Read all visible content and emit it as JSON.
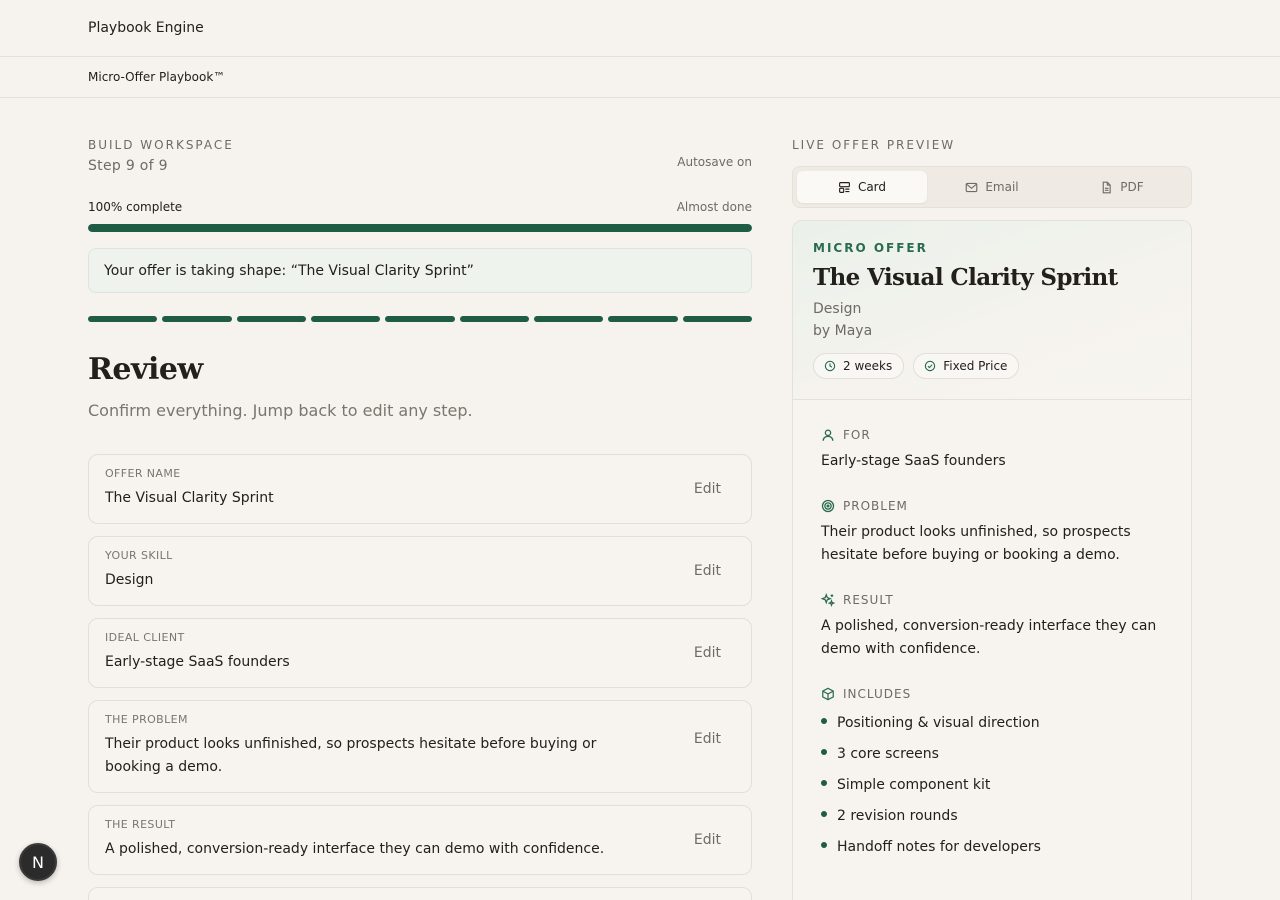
{
  "app": {
    "title": "Playbook Engine",
    "subtitle": "Micro-Offer Playbook™"
  },
  "workspace": {
    "eyebrow": "BUILD WORKSPACE",
    "step": "Step 9 of 9",
    "autosave": "Autosave on",
    "progress_label": "100% complete",
    "progress_hint": "Almost done",
    "progress_fraction": 1.0,
    "message": "Your offer is taking shape: “The Visual Clarity Sprint”",
    "steps_total": 9,
    "steps_completed": 9
  },
  "review": {
    "title": "Review",
    "subtitle": "Confirm everything. Jump back to edit any step.",
    "edit_label": "Edit",
    "items": [
      {
        "label": "OFFER NAME",
        "value": "The Visual Clarity Sprint"
      },
      {
        "label": "YOUR SKILL",
        "value": "Design"
      },
      {
        "label": "IDEAL CLIENT",
        "value": "Early-stage SaaS founders"
      },
      {
        "label": "THE PROBLEM",
        "value": "Their product looks unfinished, so prospects hesitate before buying or booking a demo."
      },
      {
        "label": "THE RESULT",
        "value": "A polished, conversion-ready interface they can demo with confidence."
      }
    ]
  },
  "preview": {
    "eyebrow": "LIVE OFFER PREVIEW",
    "tabs": [
      {
        "label": "Card",
        "icon": "layout-icon",
        "active": true
      },
      {
        "label": "Email",
        "icon": "mail-icon",
        "active": false
      },
      {
        "label": "PDF",
        "icon": "file-icon",
        "active": false
      }
    ],
    "kicker": "MICRO OFFER",
    "title": "The Visual Clarity Sprint",
    "skill": "Design",
    "author": "by Maya",
    "duration": "2 weeks",
    "pricing": "Fixed Price",
    "for_label": "FOR",
    "for_text": "Early-stage SaaS founders",
    "problem_label": "PROBLEM",
    "problem_text": "Their product looks unfinished, so prospects hesitate before buying or booking a demo.",
    "result_label": "RESULT",
    "result_text": "A polished, conversion-ready interface they can demo with confidence.",
    "includes_label": "INCLUDES",
    "includes": [
      "Positioning & visual direction",
      "3 core screens",
      "Simple component kit",
      "2 revision rounds",
      "Handoff notes for developers"
    ]
  },
  "badge": {
    "letter": "N"
  },
  "colors": {
    "accent": "#1f5c45",
    "background": "#f6f3ee"
  }
}
